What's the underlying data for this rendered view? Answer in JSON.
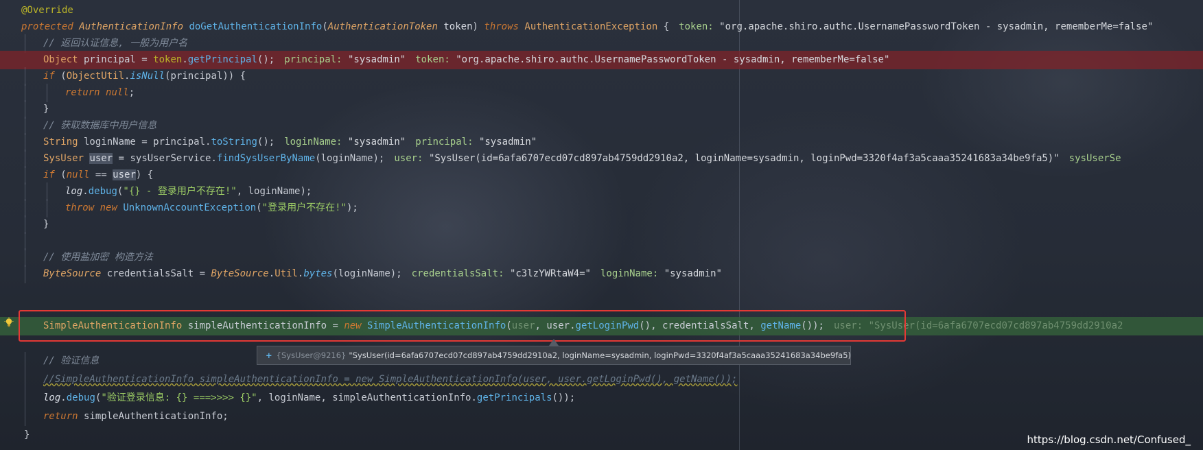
{
  "code": {
    "annotation": "@Override",
    "signature": {
      "kw_protected": "protected",
      "return_type": "AuthenticationInfo",
      "method": "doGetAuthenticationInfo",
      "param_open": "(",
      "param_type": "AuthenticationToken",
      "param_name": "token",
      "param_close": ")",
      "kw_throws": "throws",
      "exception": "AuthenticationException",
      "brace": "{",
      "hint_key": "token:",
      "hint_val": "\"org.apache.shiro.authc.UsernamePasswordToken - sysadmin, rememberMe=false\""
    },
    "comment_principal": "// 返回认证信息, 一般为用户名",
    "principal_line": {
      "type": "Object",
      "rest1": " principal = ",
      "token": "token",
      "dot": ".",
      "call": "getPrincipal",
      "end": "();",
      "hint1_key": "principal:",
      "hint1_val": "\"sysadmin\"",
      "hint2_key": "token:",
      "hint2_val": "\"org.apache.shiro.authc.UsernamePasswordToken - sysadmin, rememberMe=false\""
    },
    "if_null": {
      "kw": "if",
      "open": " (",
      "cls": "ObjectUtil",
      "dot": ".",
      "call": "isNull",
      "rest": "(principal)) {"
    },
    "return_null": {
      "kw_return": "return",
      "kw_null": "null",
      "end": ";"
    },
    "close_brace": "}",
    "comment_db": "// 获取数据库中用户信息",
    "login_line": {
      "type": "String",
      "rest1": " loginName = principal.",
      "call": "toString",
      "end": "();",
      "hint1_key": "loginName:",
      "hint1_val": "\"sysadmin\"",
      "hint2_key": "principal:",
      "hint2_val": "\"sysadmin\""
    },
    "user_line": {
      "type": "SysUser",
      "var": "user",
      "rest1": " = sysUserService.",
      "call": "findSysUserByName",
      "end": "(loginName);",
      "hint1_key": "user:",
      "hint1_val": "\"SysUser(id=6afa6707ecd07cd897ab4759dd2910a2, loginName=sysadmin, loginPwd=3320f4af3a5caaa35241683a34be9fa5)\"",
      "hint2_key": "sysUserSe"
    },
    "if_user": {
      "kw": "if",
      "open": " (",
      "kw_null": "null",
      "mid": " == ",
      "var": "user",
      "end": ") {"
    },
    "log_debug": {
      "obj": "log",
      "dot": ".",
      "call": "debug",
      "open": "(",
      "str": "\"{} - 登录用户不存在!\"",
      "end": ", loginName);"
    },
    "throw_line": {
      "kw_throw": "throw",
      "kw_new": "new",
      "cls": "UnknownAccountException",
      "open": "(",
      "str": "\"登录用户不存在!\"",
      "end": ");"
    },
    "comment_salt": "// 使用盐加密 构造方法",
    "salt_line": {
      "type": "ByteSource",
      "rest1": " credentialsSalt = ",
      "cls": "ByteSource",
      "dot1": ".",
      "util": "Util",
      "dot2": ".",
      "call": "bytes",
      "end": "(loginName);",
      "hint1_key": "credentialsSalt:",
      "hint1_val": "\"c3lzYWRtaW4=\"",
      "hint2_key": "loginName:",
      "hint2_val": "\"sysadmin\""
    },
    "simple_line": {
      "type": "SimpleAuthenticationInfo",
      "rest1": " simpleAuthenticationInfo = ",
      "kw_new": "new",
      "cls": "SimpleAuthenticationInfo",
      "open": "(",
      "arg_user": "user",
      "rest2": ", user.",
      "call1": "getLoginPwd",
      "rest3": "(), credentialsSalt, ",
      "call2": "getName",
      "end": "());",
      "hint1_key": "user:",
      "hint1_val": "\"SysUser(id=6afa6707ecd07cd897ab4759dd2910a2"
    },
    "comment_verify": "// 验证信息",
    "commented_code": "//SimpleAuthenticationInfo simpleAuthenticationInfo = new SimpleAuthenticationInfo(user, user.getLoginPwd(), getName());",
    "log_verify": {
      "obj": "log",
      "dot": ".",
      "call": "debug",
      "open": "(",
      "str": "\"验证登录信息: {} ===>>>> {}\"",
      "rest": ", loginName, simpleAuthenticationInfo.",
      "call2": "getPrincipals",
      "end": "());"
    },
    "return_info": {
      "kw_return": "return",
      "rest": " simpleAuthenticationInfo;"
    },
    "final_brace": "}"
  },
  "tooltip": {
    "expand": "+",
    "ref": "{SysUser@9216}",
    "value": "\"SysUser(id=6afa6707ecd07cd897ab4759dd2910a2, loginName=sysadmin, loginPwd=3320f4af3a5caaa35241683a34be9fa5)\""
  },
  "watermark": "https://blog.csdn.net/Confused_",
  "icons": {
    "intention_bulb": "lightbulb-icon"
  },
  "colors": {
    "error_line": "#822228",
    "current_line": "#34603a",
    "highlight_box": "#e53935",
    "keyword": "#cc7832",
    "string": "#9ccc65",
    "method": "#5fb3e8"
  }
}
